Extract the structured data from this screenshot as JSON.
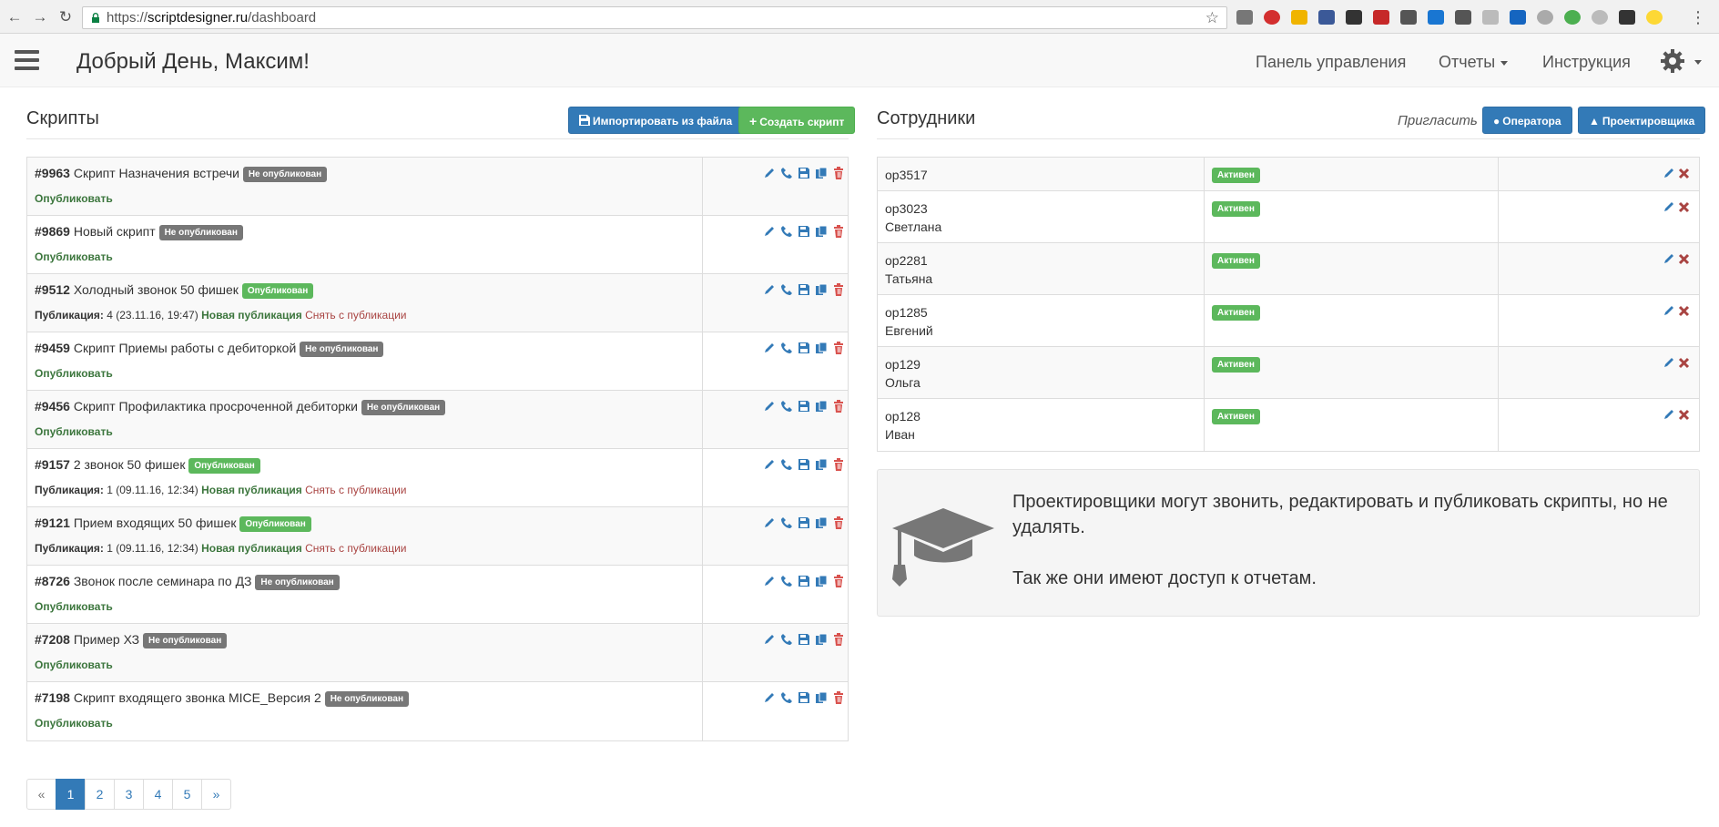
{
  "browser": {
    "url_scheme": "https://",
    "url_host": "scriptdesigner.ru",
    "url_path": "/dashboard"
  },
  "navbar": {
    "greeting": "Добрый День, Максим!",
    "links": [
      "Панель управления",
      "Отчеты",
      "Инструкция"
    ]
  },
  "scripts": {
    "title": "Скрипты",
    "import_button": "Импортировать из файла",
    "create_button": "Создать скрипт",
    "rows": [
      {
        "id": "#9963",
        "name": "Скрипт Назначения встречи",
        "status": "Не опубликован",
        "published": false,
        "action": "Опубликовать"
      },
      {
        "id": "#9869",
        "name": "Новый скрипт",
        "status": "Не опубликован",
        "published": false,
        "action": "Опубликовать"
      },
      {
        "id": "#9512",
        "name": "Холодный звонок 50 фишек",
        "status": "Опубликован",
        "published": true,
        "pub_label": "Публикация:",
        "pub_num": "4",
        "pub_date": "(23.11.16, 19:47)",
        "new_pub": "Новая публикация",
        "unpub": "Снять с публикации"
      },
      {
        "id": "#9459",
        "name": "Скрипт Приемы работы с дебиторкой",
        "status": "Не опубликован",
        "published": false,
        "action": "Опубликовать"
      },
      {
        "id": "#9456",
        "name": "Скрипт Профилактика просроченной дебиторки",
        "status": "Не опубликован",
        "published": false,
        "action": "Опубликовать"
      },
      {
        "id": "#9157",
        "name": "2 звонок 50 фишек",
        "status": "Опубликован",
        "published": true,
        "pub_label": "Публикация:",
        "pub_num": "1",
        "pub_date": "(09.11.16, 12:34)",
        "new_pub": "Новая публикация",
        "unpub": "Снять с публикации"
      },
      {
        "id": "#9121",
        "name": "Прием входящих 50 фишек",
        "status": "Опубликован",
        "published": true,
        "pub_label": "Публикация:",
        "pub_num": "1",
        "pub_date": "(09.11.16, 12:34)",
        "new_pub": "Новая публикация",
        "unpub": "Снять с публикации"
      },
      {
        "id": "#8726",
        "name": "Звонок после семинара по ДЗ",
        "status": "Не опубликован",
        "published": false,
        "action": "Опубликовать"
      },
      {
        "id": "#7208",
        "name": "Пример ХЗ",
        "status": "Не опубликован",
        "published": false,
        "action": "Опубликовать"
      },
      {
        "id": "#7198",
        "name": "Скрипт входящего звонка MICE_Версия 2",
        "status": "Не опубликован",
        "published": false,
        "action": "Опубликовать"
      }
    ]
  },
  "employees": {
    "title": "Сотрудники",
    "invite_label": "Пригласить",
    "invite_operator": "Оператора",
    "invite_designer": "Проектировщика",
    "rows": [
      {
        "login": "op3517",
        "name": "",
        "status": "Активен"
      },
      {
        "login": "op3023",
        "name": "Светлана",
        "status": "Активен"
      },
      {
        "login": "op2281",
        "name": "Татьяна",
        "status": "Активен"
      },
      {
        "login": "op1285",
        "name": "Евгений",
        "status": "Активен"
      },
      {
        "login": "op129",
        "name": "Ольга",
        "status": "Активен"
      },
      {
        "login": "op128",
        "name": "Иван",
        "status": "Активен"
      }
    ]
  },
  "info": {
    "line1": "Проектировщики могут звонить, редактировать и публиковать скрипты, но не удалять.",
    "line2": "Так же они имеют доступ к отчетам."
  },
  "pagination": {
    "prev": "«",
    "pages": [
      "1",
      "2",
      "3",
      "4",
      "5"
    ],
    "active": "1",
    "next": "»"
  },
  "colors": {
    "primary": "#337ab7",
    "success": "#5cb85c",
    "label_default": "#777777",
    "danger": "#a94442",
    "link_green": "#3c763d"
  }
}
